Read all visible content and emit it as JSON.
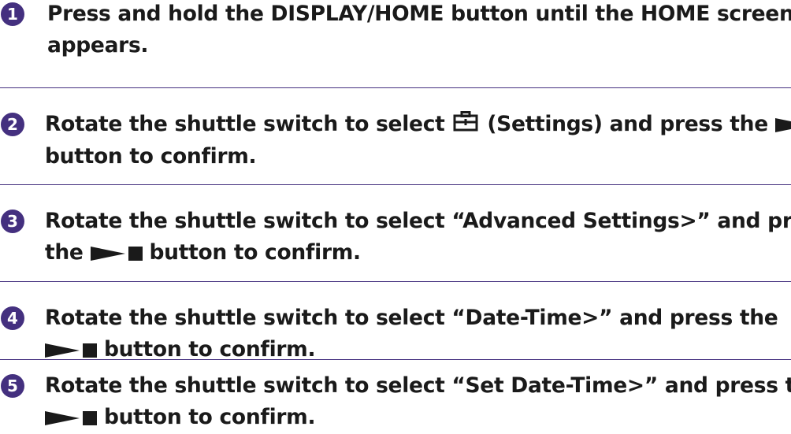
{
  "accent_color": "#44307f",
  "steps": [
    {
      "number": "1",
      "line1": "Press and hold the DISPLAY/HOME button until the HOME screen",
      "line2": "appears."
    },
    {
      "number": "2",
      "line1_a": "Rotate the shuttle switch to select",
      "line1_b": "(Settings) and press the",
      "line2": "button to confirm."
    },
    {
      "number": "3",
      "line1": "Rotate the shuttle switch to select “Advanced Settings>” and press",
      "line2_a": "the",
      "line2_b": "button to confirm."
    },
    {
      "number": "4",
      "line1": "Rotate the shuttle switch to select “Date-Time>” and press the",
      "line2": "button to confirm."
    },
    {
      "number": "5",
      "line1": "Rotate the shuttle switch to select “Set Date-Time>” and press the",
      "line2": "button to confirm."
    }
  ],
  "icons": {
    "settings": "settings-icon",
    "play_stop": "play-stop-icon"
  }
}
